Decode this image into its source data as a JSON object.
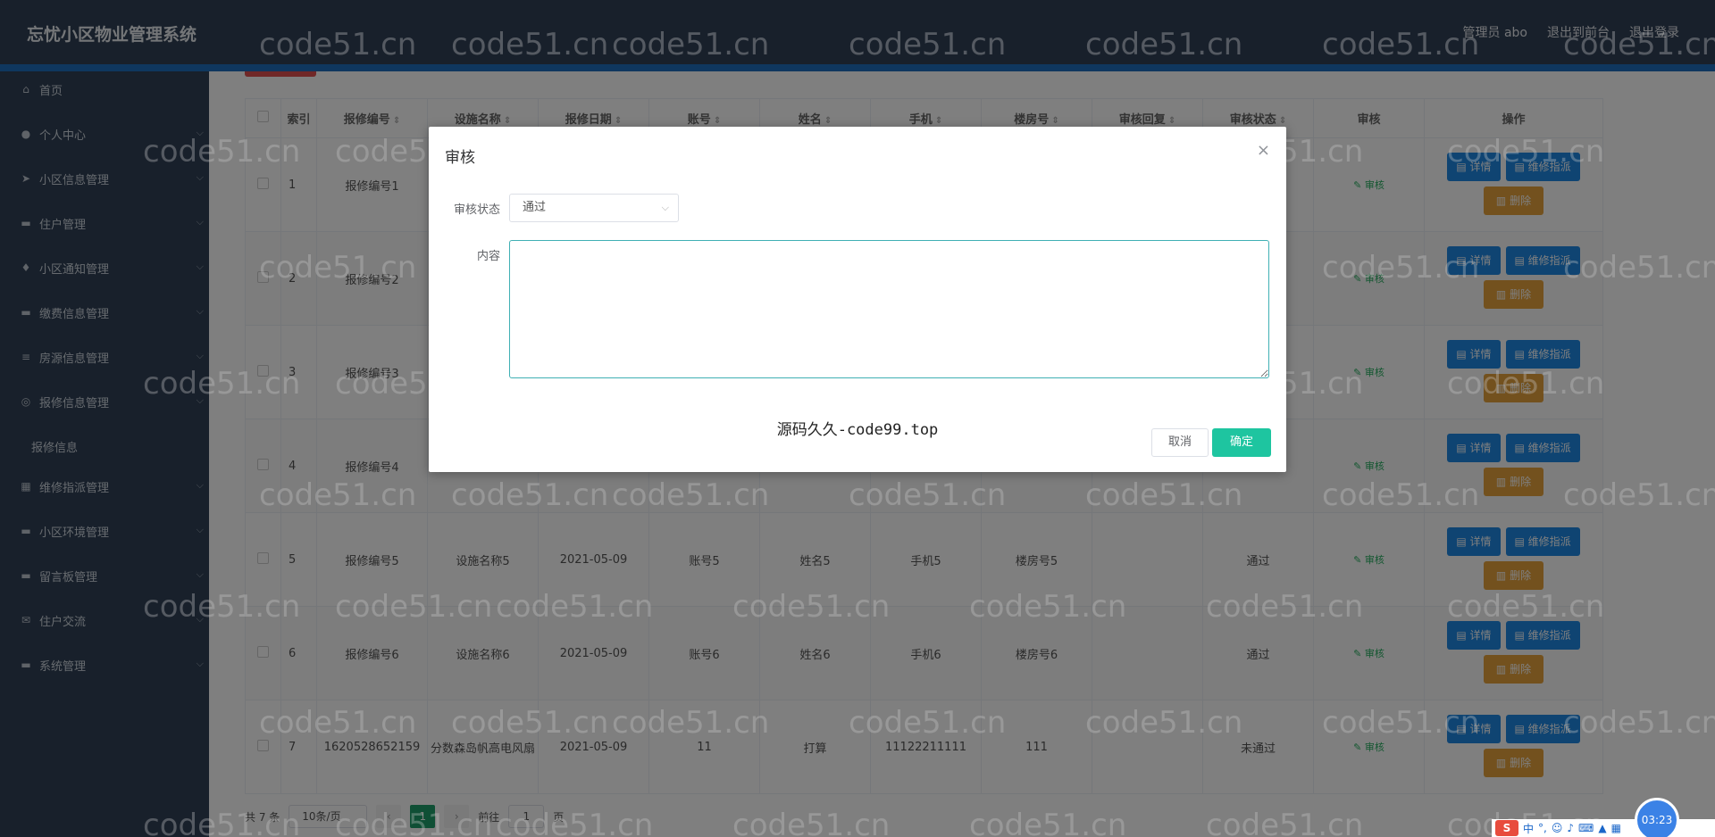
{
  "app_title": "忘忧小区物业管理系统",
  "header_links": [
    "管理员 abo",
    "退出到前台",
    "退出登录"
  ],
  "sidebar": {
    "items": [
      {
        "label": "首页",
        "icon": "home-icon",
        "chev": false
      },
      {
        "label": "个人中心",
        "icon": "user-icon",
        "chev": true
      },
      {
        "label": "小区信息管理",
        "icon": "send-icon",
        "chev": true
      },
      {
        "label": "住户管理",
        "icon": "monitor-icon",
        "chev": true
      },
      {
        "label": "小区通知管理",
        "icon": "mic-icon",
        "chev": true
      },
      {
        "label": "缴费信息管理",
        "icon": "wallet-icon",
        "chev": true
      },
      {
        "label": "房源信息管理",
        "icon": "list-icon",
        "chev": true
      },
      {
        "label": "报修信息管理",
        "icon": "globe-icon",
        "chev": true
      },
      {
        "label": "报修信息",
        "icon": "",
        "chev": false,
        "sub": true
      },
      {
        "label": "维修指派管理",
        "icon": "grid-icon",
        "chev": true
      },
      {
        "label": "小区环境管理",
        "icon": "chat-icon",
        "chev": true
      },
      {
        "label": "留言板管理",
        "icon": "bag-icon",
        "chev": true
      },
      {
        "label": "住户交流",
        "icon": "mail-icon",
        "chev": true
      },
      {
        "label": "系统管理",
        "icon": "server-icon",
        "chev": true
      }
    ]
  },
  "table": {
    "headers": [
      "",
      "索引",
      "报修编号",
      "设施名称",
      "报修日期",
      "账号",
      "姓名",
      "手机",
      "楼房号",
      "审核回复",
      "审核状态",
      "审核",
      "操作"
    ],
    "rows": [
      [
        "1",
        "报修编号1",
        "",
        "",
        "",
        "",
        "",
        "",
        "",
        ""
      ],
      [
        "2",
        "报修编号2",
        "",
        "",
        "",
        "",
        "",
        "",
        "",
        ""
      ],
      [
        "3",
        "报修编号3",
        "",
        "",
        "",
        "",
        "",
        "",
        "",
        ""
      ],
      [
        "4",
        "报修编号4",
        "",
        "",
        "",
        "",
        "",
        "",
        "",
        ""
      ],
      [
        "5",
        "报修编号5",
        "设施名称5",
        "2021-05-09",
        "账号5",
        "姓名5",
        "手机5",
        "楼房号5",
        "",
        "通过"
      ],
      [
        "6",
        "报修编号6",
        "设施名称6",
        "2021-05-09",
        "账号6",
        "姓名6",
        "手机6",
        "楼房号6",
        "",
        "通过"
      ],
      [
        "7",
        "1620528652159",
        "分数森岛帆高电风扇",
        "2021-05-09",
        "11",
        "打算",
        "11122211111",
        "111",
        "",
        "未通过"
      ]
    ],
    "audit_label": "审核",
    "detail_label": "详情",
    "assign_label": "维修指派",
    "delete_label": "删除"
  },
  "pagination": {
    "total": "共 7 条",
    "page_size": "10条/页",
    "current": "1",
    "goto_prefix": "前往",
    "goto_value": "1",
    "goto_suffix": "页"
  },
  "dialog": {
    "title": "审核",
    "status_label": "审核状态",
    "status_value": "通过",
    "content_label": "内容",
    "center_text": "源码久久-code99.top",
    "cancel": "取消",
    "confirm": "确定"
  },
  "watermark": "code51.cn",
  "timer": "03:23",
  "taskbar": {
    "logo": "S",
    "lang": "中"
  }
}
